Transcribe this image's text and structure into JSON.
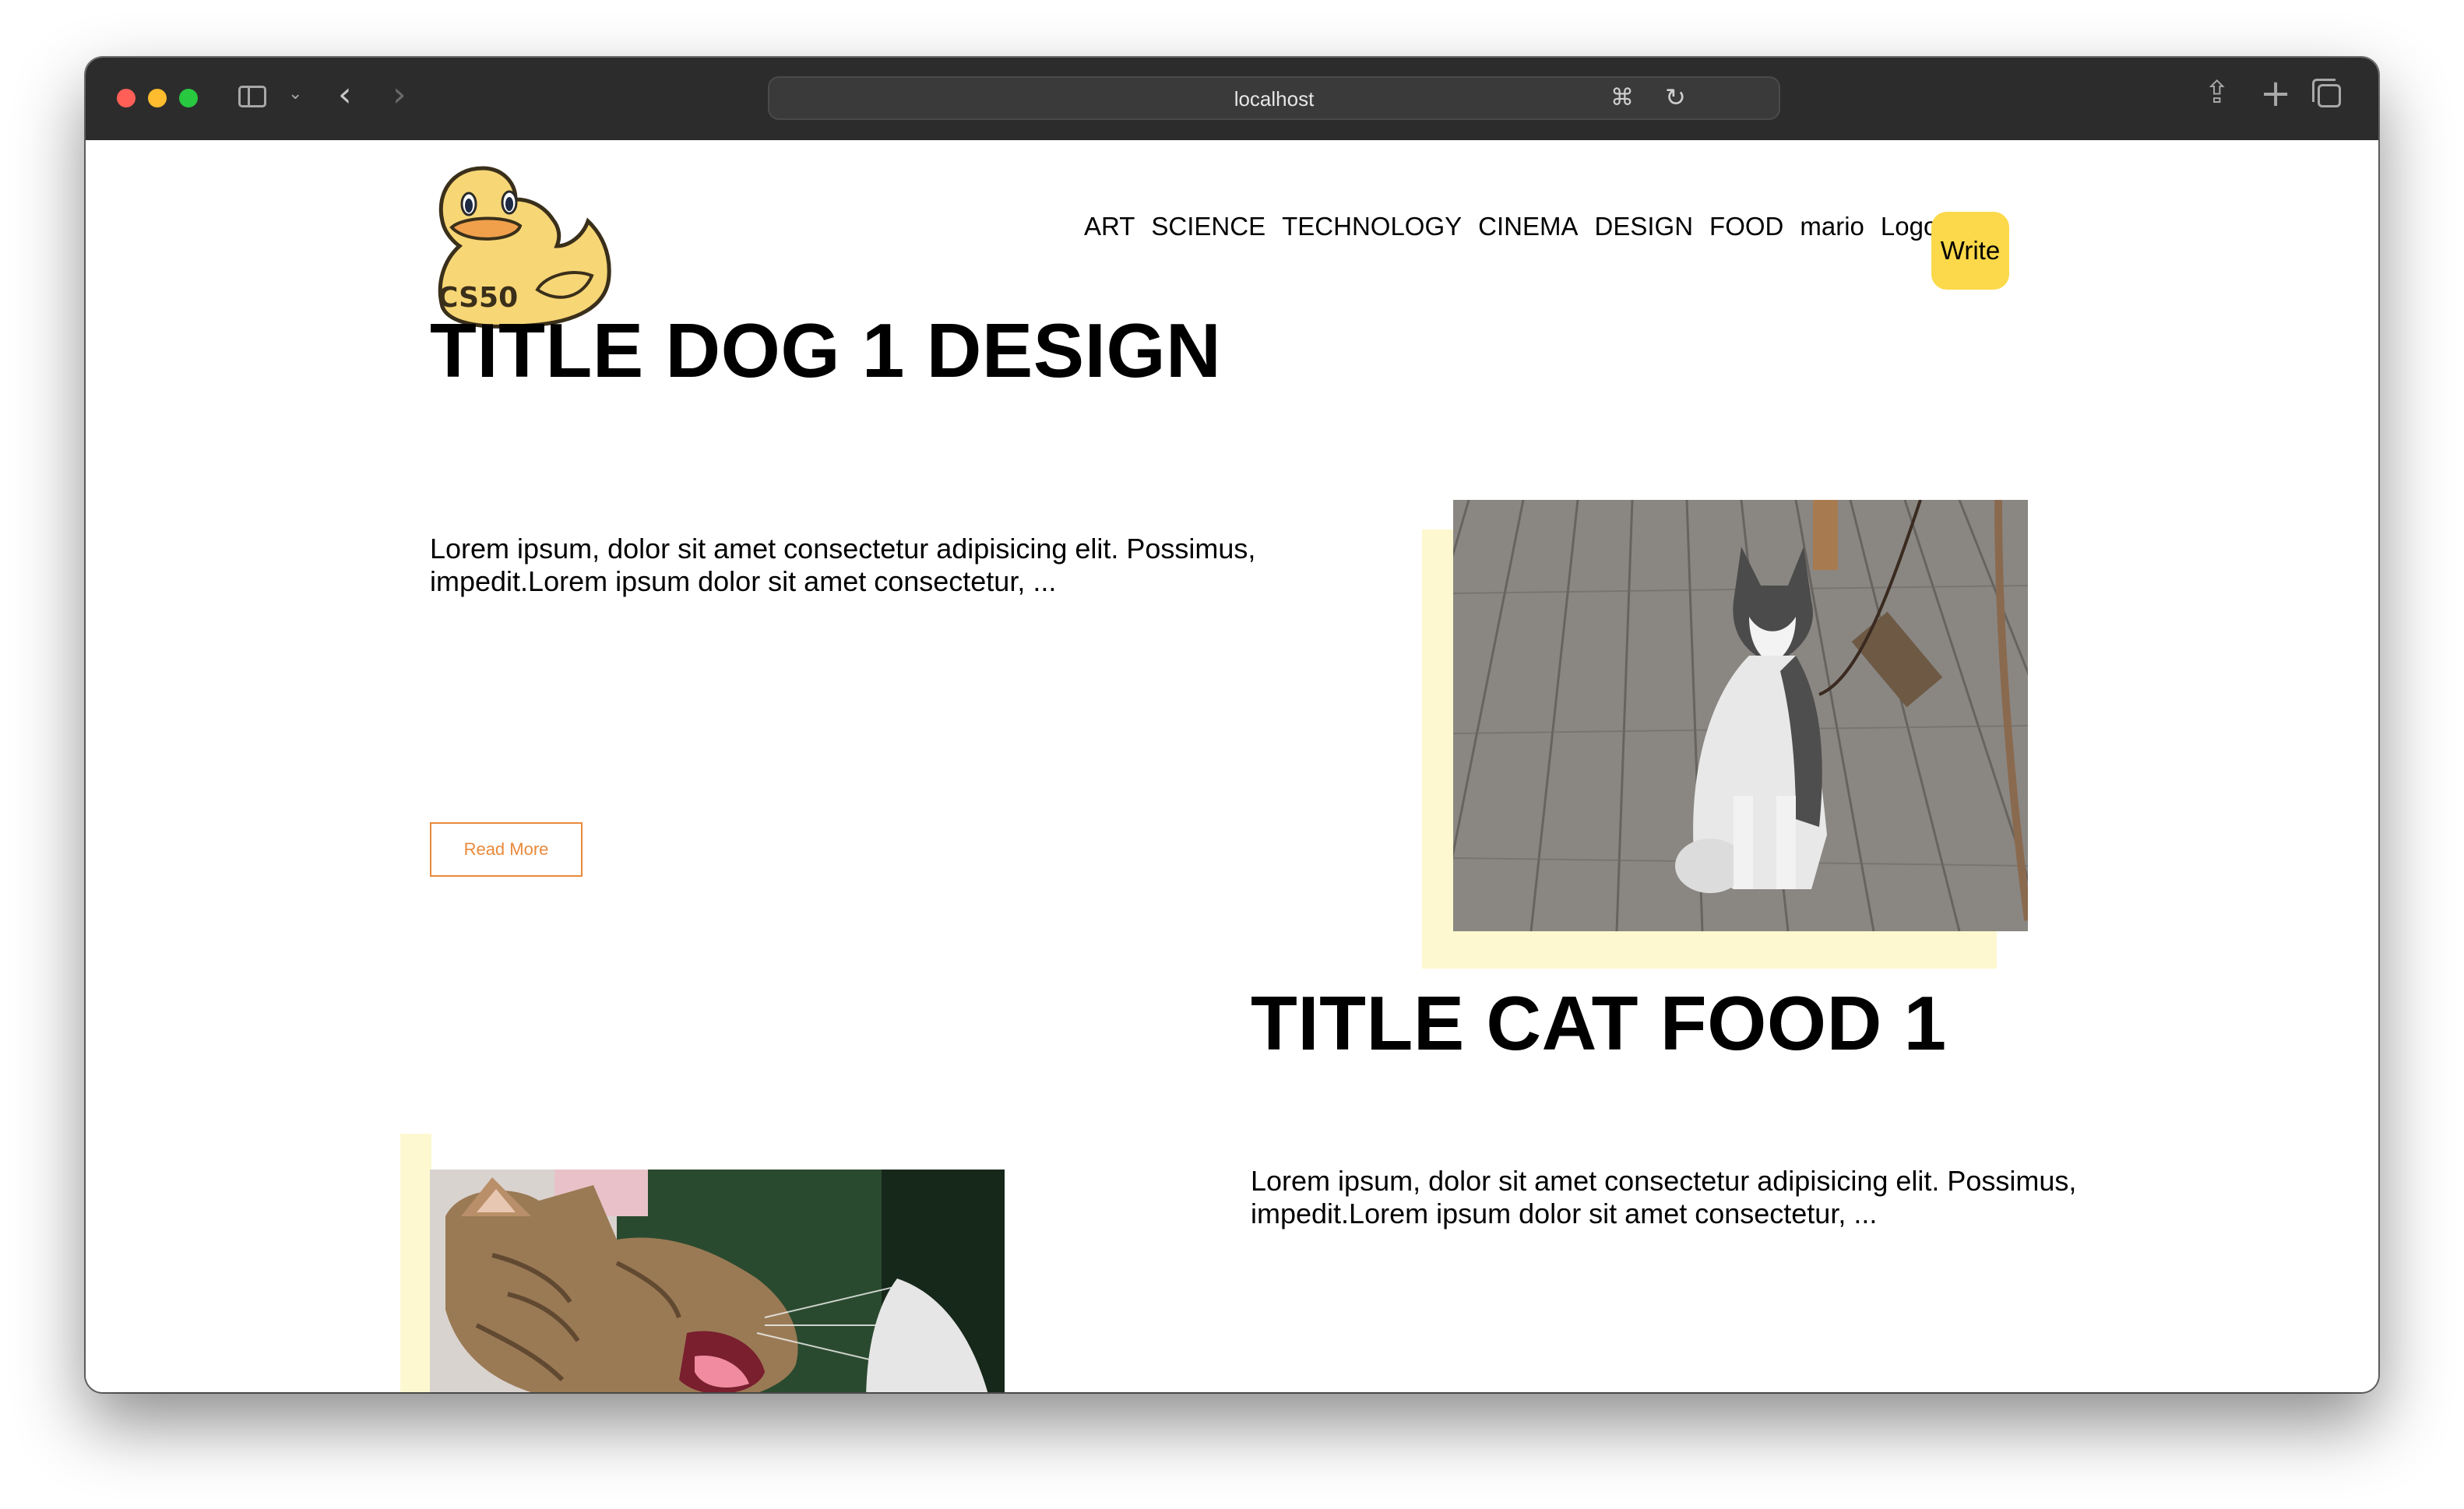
{
  "browser": {
    "address": "localhost"
  },
  "site": {
    "logo_text": "CS50",
    "nav": [
      "ART",
      "SCIENCE",
      "TECHNOLOGY",
      "CINEMA",
      "DESIGN",
      "FOOD",
      "mario",
      "Logout"
    ],
    "write_label": "Write",
    "accent_color": "#fbd94a",
    "highlight_color": "#fdf8cf",
    "read_more_color": "#e8893b"
  },
  "posts": [
    {
      "title": "TITLE DOG 1 DESIGN",
      "excerpt_line1": "Lorem ipsum, dolor sit amet consectetur adipisicing elit. Possimus,",
      "excerpt_line2": "impedit.Lorem ipsum dolor sit amet consectetur, ...",
      "read_more": "Read More",
      "image": "husky-dog-photo"
    },
    {
      "title": "TITLE CAT FOOD 1",
      "excerpt_line1": "Lorem ipsum, dolor sit amet consectetur adipisicing elit. Possimus,",
      "excerpt_line2": "impedit.Lorem ipsum dolor sit amet consectetur, ...",
      "image": "yawning-cat-photo"
    }
  ]
}
